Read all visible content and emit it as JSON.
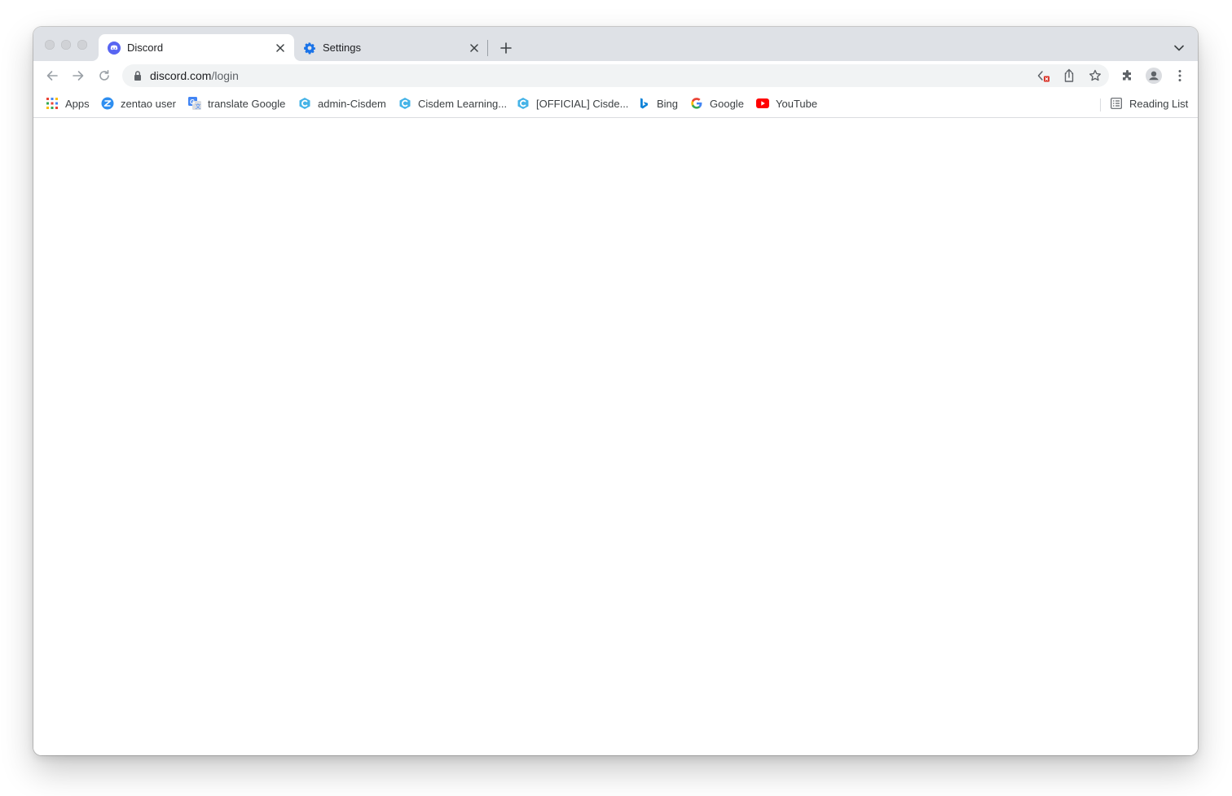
{
  "browser": {
    "tabs": [
      {
        "title": "Discord",
        "active": true,
        "icon": "discord-icon"
      },
      {
        "title": "Settings",
        "active": false,
        "icon": "gear-icon"
      }
    ],
    "address_bar": {
      "domain": "discord.com",
      "path": "/login"
    },
    "bookmarks": [
      {
        "label": "Apps",
        "icon": "apps-grid-icon"
      },
      {
        "label": "zentao user",
        "icon": "zentao-icon"
      },
      {
        "label": "translate Google",
        "icon": "google-translate-icon"
      },
      {
        "label": "admin-Cisdem",
        "icon": "cisdem-icon"
      },
      {
        "label": "Cisdem Learning...",
        "icon": "cisdem-icon"
      },
      {
        "label": "[OFFICIAL] Cisde...",
        "icon": "cisdem-icon"
      },
      {
        "label": "Bing",
        "icon": "bing-icon"
      },
      {
        "label": "Google",
        "icon": "google-icon"
      },
      {
        "label": "YouTube",
        "icon": "youtube-icon"
      }
    ],
    "reading_list": {
      "label": "Reading List",
      "icon": "reading-list-icon"
    }
  },
  "colors": {
    "tabstrip_bg": "#dee1e6",
    "omnibox_bg": "#f1f3f4",
    "discord_blurple": "#5865f2",
    "settings_blue": "#1a73e8",
    "youtube_red": "#ff0000"
  }
}
